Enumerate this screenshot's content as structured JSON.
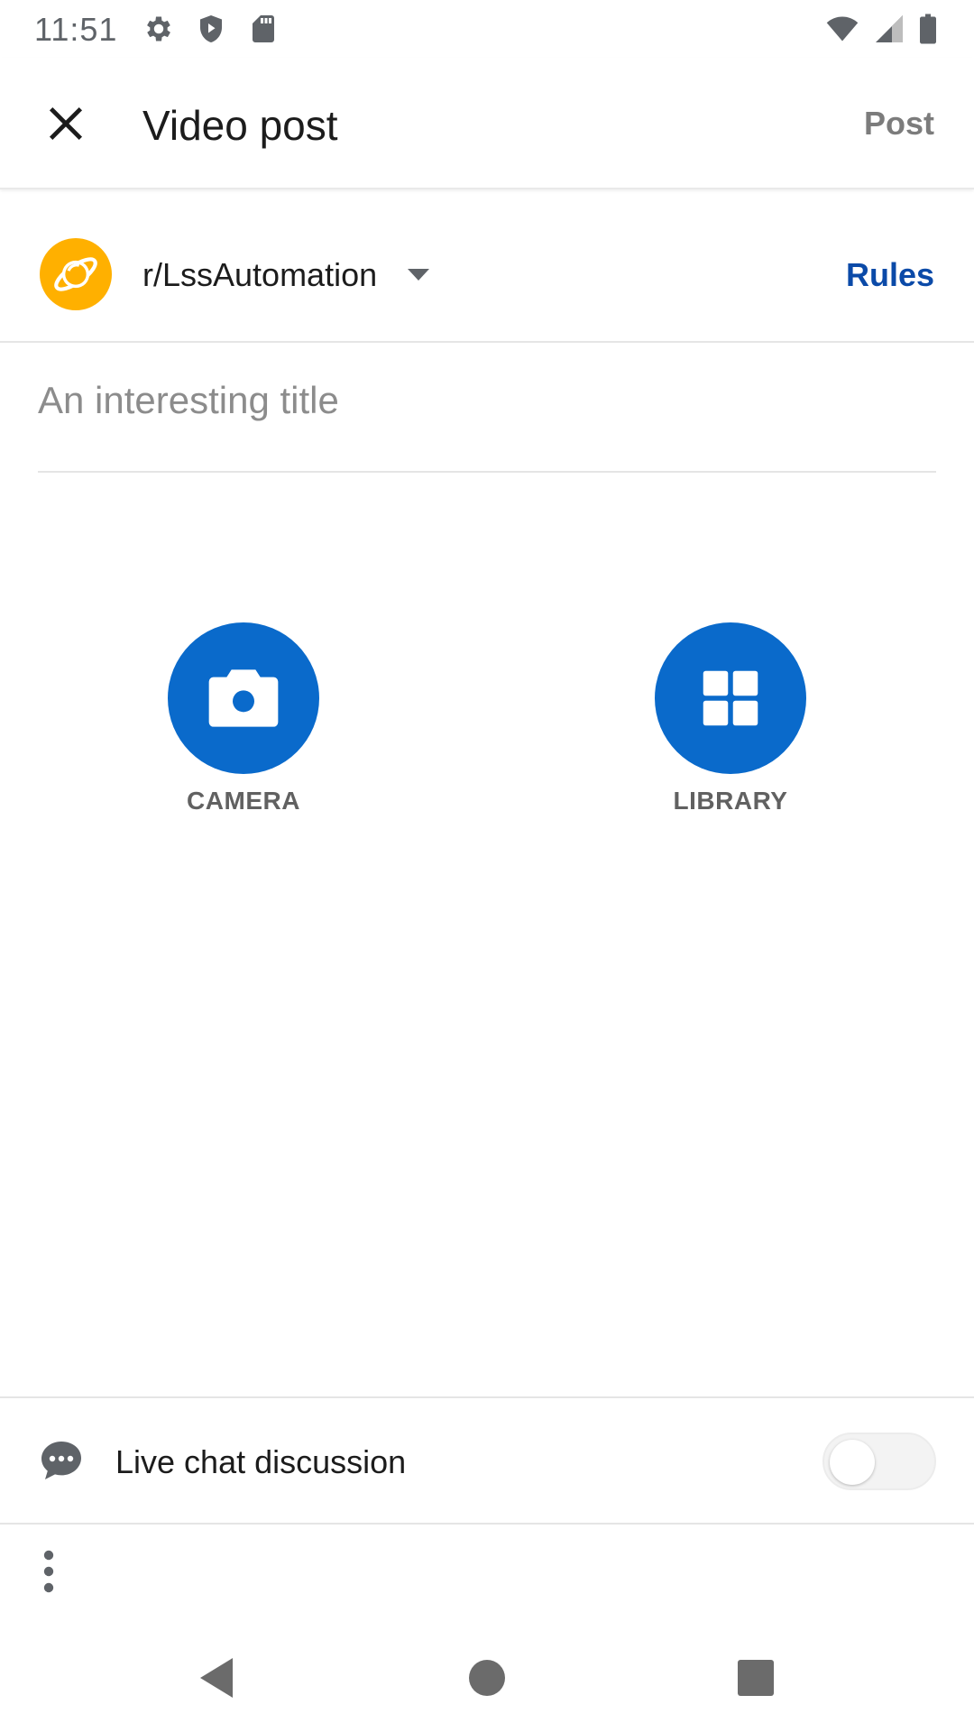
{
  "status_bar": {
    "time": "11:51",
    "left_icons": [
      "settings-icon",
      "shield-icon",
      "sd-card-icon"
    ],
    "right_icons": [
      "wifi-icon",
      "signal-icon",
      "battery-icon"
    ]
  },
  "app_bar": {
    "close_icon": "close-icon",
    "title": "Video post",
    "post_label": "Post"
  },
  "community": {
    "name": "r/LssAutomation",
    "avatar_color": "#ffb000",
    "rules_label": "Rules"
  },
  "title_field": {
    "value": "",
    "placeholder": "An interesting title"
  },
  "media_options": {
    "camera_label": "CAMERA",
    "library_label": "LIBRARY",
    "accent": "#0a6acb"
  },
  "live_chat": {
    "label": "Live chat discussion",
    "enabled": false
  },
  "colors": {
    "primary_blue": "#0a6acb",
    "link_blue": "#0b4aa8",
    "muted_text": "#7c7c7c"
  }
}
